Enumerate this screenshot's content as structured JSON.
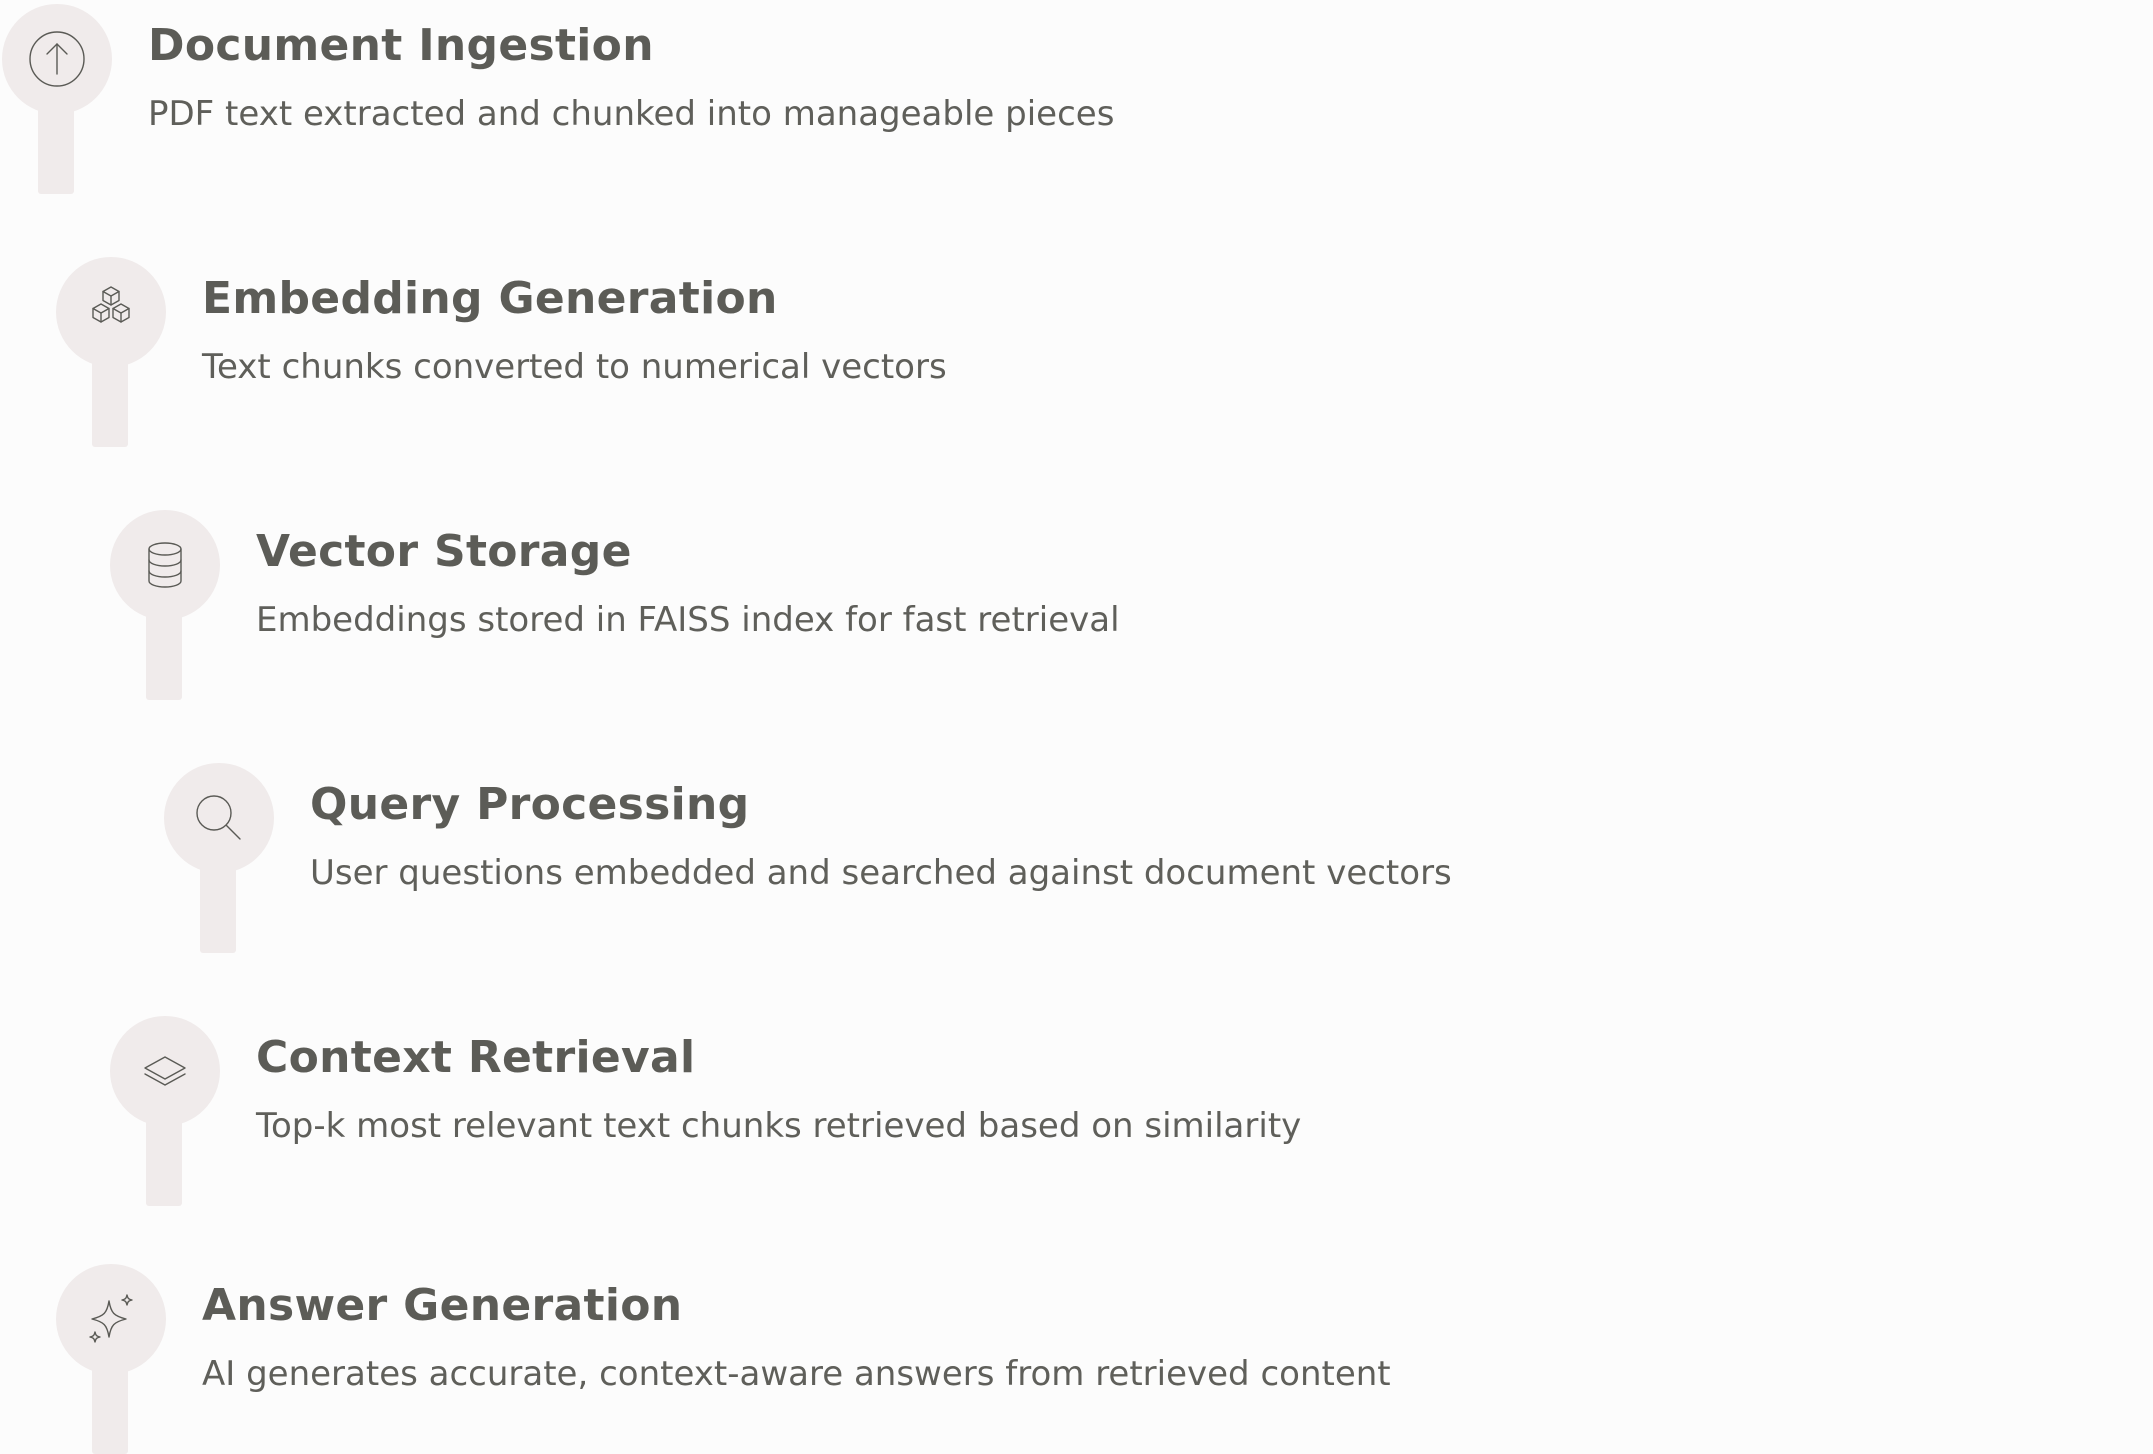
{
  "steps": [
    {
      "icon": "arrow-up-circle-icon",
      "title": "Document Ingestion",
      "description": "PDF text extracted and chunked into manageable pieces"
    },
    {
      "icon": "cubes-icon",
      "title": "Embedding Generation",
      "description": "Text chunks converted to numerical vectors"
    },
    {
      "icon": "database-icon",
      "title": "Vector Storage",
      "description": "Embeddings stored in FAISS index for fast retrieval"
    },
    {
      "icon": "search-icon",
      "title": "Query Processing",
      "description": "User questions embedded and searched against document vectors"
    },
    {
      "icon": "layers-icon",
      "title": "Context Retrieval",
      "description": "Top-k most relevant text chunks retrieved based on similarity"
    },
    {
      "icon": "sparkles-icon",
      "title": "Answer Generation",
      "description": "AI generates accurate, context-aware answers from retrieved content"
    }
  ],
  "colors": {
    "background": "#fcfcfc",
    "pin": "#f0ebeb",
    "title": "#5c5c57",
    "description": "#5f5f5a",
    "icon_stroke": "#5a5a55"
  }
}
